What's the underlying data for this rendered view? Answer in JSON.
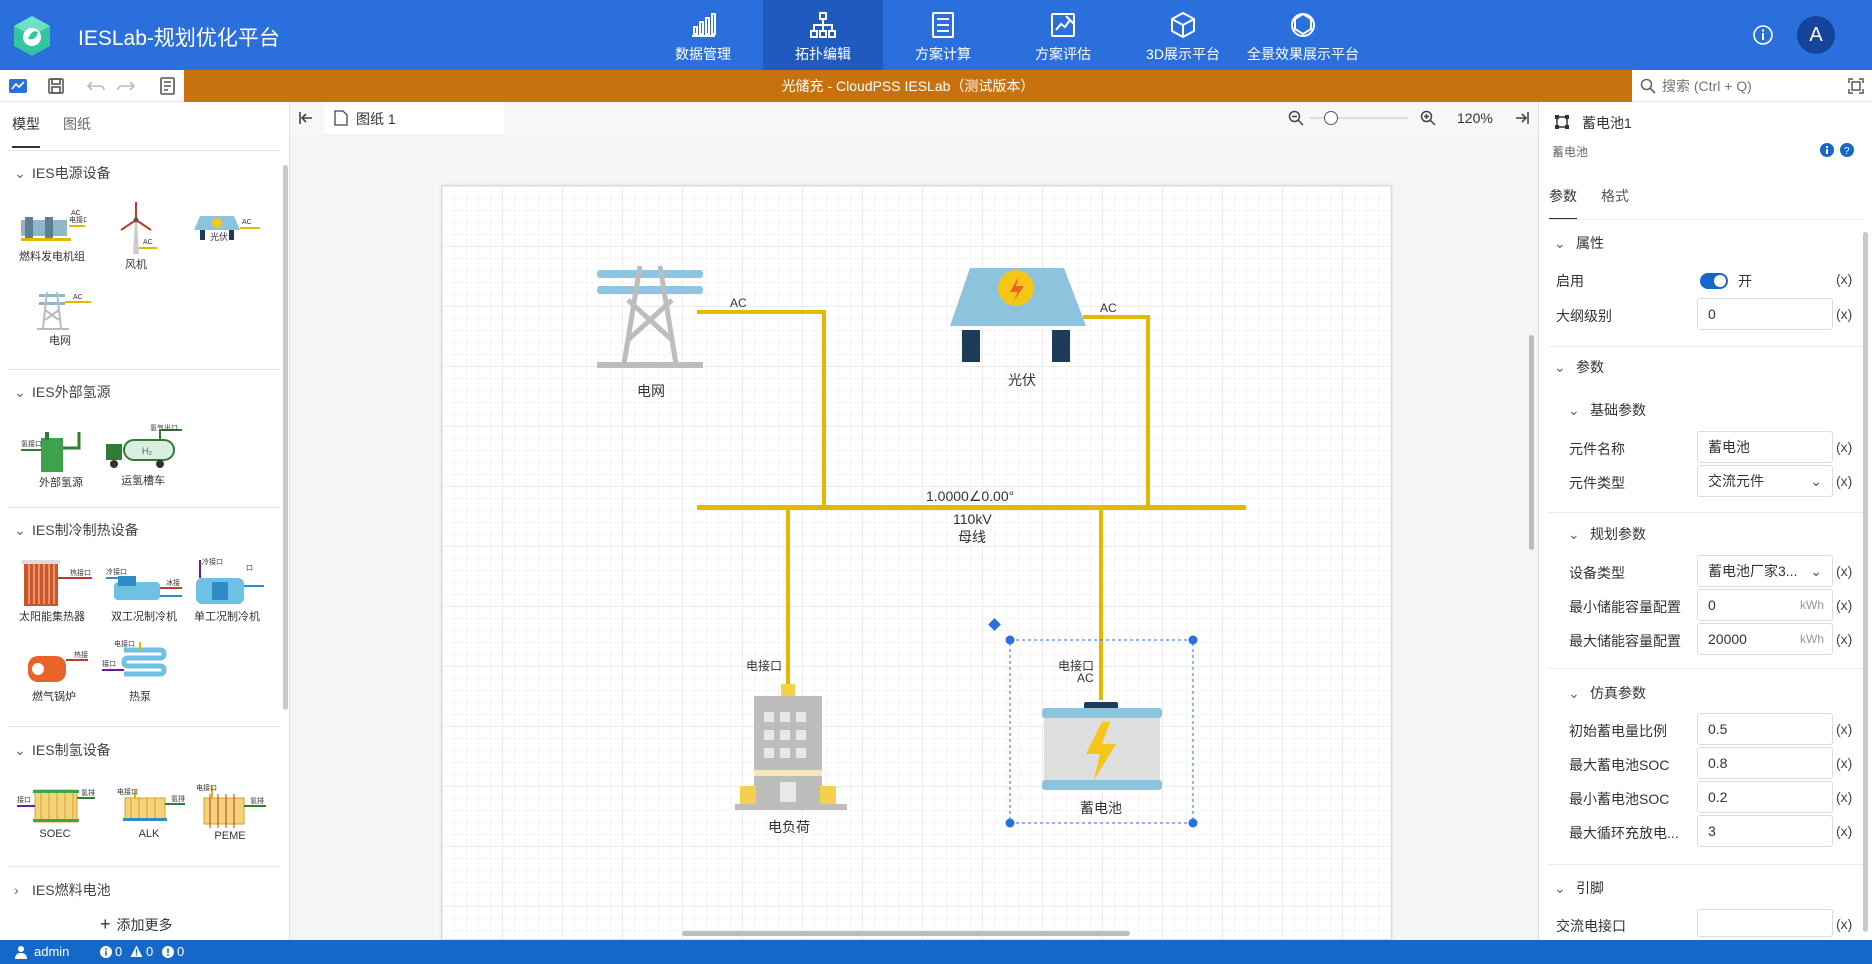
{
  "app": {
    "title": "IESLab-规划优化平台",
    "avatar_letter": "A"
  },
  "nav": [
    {
      "label": "数据管理",
      "icon": "bar-chart-icon"
    },
    {
      "label": "拓扑编辑",
      "icon": "topology-icon",
      "active": true
    },
    {
      "label": "方案计算",
      "icon": "document-list-icon"
    },
    {
      "label": "方案评估",
      "icon": "edit-chart-icon"
    },
    {
      "label": "3D展示平台",
      "icon": "cube-icon"
    },
    {
      "label": "全景效果展示平台",
      "icon": "panorama-icon"
    }
  ],
  "document": {
    "title": "光储充 - CloudPSS IESLab（测试版本）"
  },
  "search": {
    "placeholder": "搜索 (Ctrl + Q)"
  },
  "left_panel": {
    "tabs": [
      "模型",
      "图纸"
    ],
    "sections": [
      {
        "title": "IES电源设备",
        "items": [
          "燃料发电机组",
          "风机",
          "光伏",
          "电网"
        ]
      },
      {
        "title": "IES外部氢源",
        "items": [
          "外部氢源",
          "运氢槽车"
        ]
      },
      {
        "title": "IES制冷制热设备",
        "items": [
          "太阳能集热器",
          "双工况制冷机",
          "单工况制冷机",
          "燃气锅炉",
          "热泵"
        ]
      },
      {
        "title": "IES制氢设备",
        "items": [
          "SOEC",
          "ALK",
          "PEME"
        ]
      },
      {
        "title": "IES燃料电池",
        "items": []
      }
    ],
    "add_more": "添加更多",
    "port_labels": {
      "ac": "AC",
      "elec": "电接口",
      "hot": "热接口",
      "cold": "冷接口",
      "h2": "氢气出口",
      "h2_short": "氢气出口",
      "power_ex": "氢接口",
      "hot_short": "热接",
      "elec_short": "电接口",
      "h2_in": "氢接口",
      "h2_out": "氢排",
      "water": "接口"
    }
  },
  "canvas": {
    "tab": "图纸 1",
    "zoom": "120%",
    "nodes": {
      "grid": "电网",
      "pv": "光伏",
      "load": "电负荷",
      "battery": "蓄电池",
      "bus_value": "1.0000∠0.00°",
      "bus_voltage": "110kV",
      "bus_name": "母线",
      "ac": "AC",
      "port": "电接口"
    }
  },
  "right_panel": {
    "title": "蓄电池1",
    "subtitle": "蓄电池",
    "tabs": [
      "参数",
      "格式"
    ],
    "attr_section": "属性",
    "enable_label": "启用",
    "enable_state": "开",
    "outline_label": "大纲级别",
    "outline_value": "0",
    "params_section": "参数",
    "basic_section": "基础参数",
    "name_label": "元件名称",
    "name_value": "蓄电池",
    "type_label": "元件类型",
    "type_value": "交流元件",
    "plan_section": "规划参数",
    "device_label": "设备类型",
    "device_value": "蓄电池厂家3...",
    "min_cap_label": "最小储能容量配置",
    "min_cap_value": "0",
    "max_cap_label": "最大储能容量配置",
    "max_cap_value": "20000",
    "unit_kwh": "kWh",
    "sim_section": "仿真参数",
    "init_label": "初始蓄电量比例",
    "init_value": "0.5",
    "max_soc_label": "最大蓄电池SOC",
    "max_soc_value": "0.8",
    "min_soc_label": "最小蓄电池SOC",
    "min_soc_value": "0.2",
    "cycle_label": "最大循环充放电...",
    "cycle_value": "3",
    "pin_section": "引脚",
    "ac_port_label": "交流电接口",
    "ac_port_value": "",
    "x": "(x)"
  },
  "status": {
    "user": "admin",
    "info": "0",
    "warn": "0",
    "err": "0"
  },
  "colors": {
    "primary": "#2a6fdc",
    "doc_bar": "#c8720f",
    "wire": "#e5b800",
    "status": "#1668c8"
  }
}
